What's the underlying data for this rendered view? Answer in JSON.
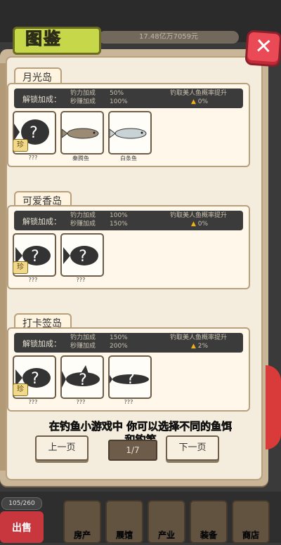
{
  "header": {
    "title": "图鉴",
    "resource_text": "17.48亿万7059元",
    "close_label": "✕"
  },
  "sections": [
    {
      "name": "月光岛",
      "bonus_title": "解锁加成：",
      "lines_left": [
        "钓力加成",
        "秒赚加成"
      ],
      "lines_mid": [
        "50%",
        "100%"
      ],
      "rate_label": "钓取美人鱼概率提升",
      "rate_value": "0%",
      "fish": [
        {
          "name": "???",
          "rare": "珍"
        },
        {
          "name": "秦腾鱼"
        },
        {
          "name": "白条鱼"
        }
      ]
    },
    {
      "name": "可爱香岛",
      "bonus_title": "解锁加成：",
      "lines_left": [
        "钓力加成",
        "秒赚加成"
      ],
      "lines_mid": [
        "100%",
        "150%"
      ],
      "rate_label": "钓取美人鱼概率提升",
      "rate_value": "0%",
      "fish": [
        {
          "name": "???",
          "rare": "珍"
        },
        {
          "name": "???"
        }
      ]
    },
    {
      "name": "打卡签岛",
      "bonus_title": "解锁加成：",
      "lines_left": [
        "钓力加成",
        "秒赚加成"
      ],
      "lines_mid": [
        "150%",
        "200%"
      ],
      "rate_label": "钓取美人鱼概率提升",
      "rate_value": "2%",
      "fish": [
        {
          "name": "???",
          "rare": "珍"
        },
        {
          "name": "???"
        },
        {
          "name": "???"
        }
      ]
    }
  ],
  "pager": {
    "prev_label": "上一页",
    "next_label": "下一页",
    "indicator": "1/7"
  },
  "subtitle": {
    "line1": "在钓鱼小游戏中 你可以选择不同的鱼饵",
    "line2": "和钓竿"
  },
  "bottom": {
    "bag_count": "105/260",
    "sell_label": "出售",
    "tiles": [
      "房产",
      "展馆",
      "产业",
      "装备",
      "商店"
    ]
  }
}
